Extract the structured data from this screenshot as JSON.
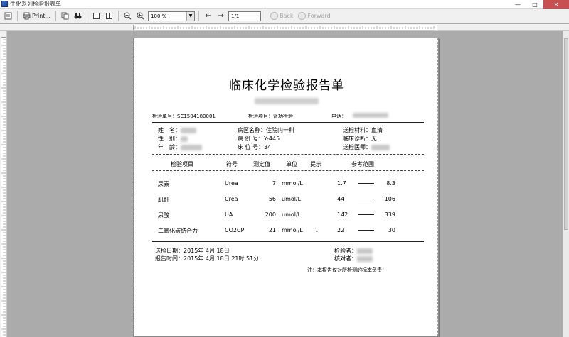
{
  "window": {
    "title": "生化系列检验报表单"
  },
  "toolbar": {
    "print_label": "Print...",
    "zoom_value": "100 %",
    "page_value": "1/1",
    "back_label": "Back",
    "forward_label": "Forward"
  },
  "report": {
    "title": "临床化学检验报告单",
    "top_row": {
      "sample_no": "检验单号：SC1504180001",
      "item": "检验项目：肾功检验",
      "phone": "电话："
    },
    "patient": {
      "name_label": "姓　名：",
      "sex_label": "性　别：",
      "age_label": "年　龄：",
      "dept": "病区名称：住院内一科",
      "record": "病 例 号：Y-445",
      "bed": "床 位 号：34",
      "material": "送检材料：血清",
      "diagnosis": "临床诊断：无",
      "doctor": "送检医师："
    },
    "columns": [
      "检验项目",
      "符号",
      "测定值",
      "单位",
      "提示",
      "参考范围"
    ],
    "rows": [
      {
        "name": "尿素",
        "symbol": "Urea",
        "value": "7",
        "unit": "mmol/L",
        "flag": "",
        "low": "1.7",
        "high": "8.3"
      },
      {
        "name": "肌酐",
        "symbol": "Crea",
        "value": "56",
        "unit": "umol/L",
        "flag": "",
        "low": "44",
        "high": "106"
      },
      {
        "name": "尿酸",
        "symbol": "UA",
        "value": "200",
        "unit": "umol/L",
        "flag": "",
        "low": "142",
        "high": "339"
      },
      {
        "name": "二氧化碳结合力",
        "symbol": "CO2CP",
        "value": "21",
        "unit": "mmol/L",
        "flag": "↓",
        "low": "22",
        "high": "30"
      }
    ],
    "footer": {
      "send_date": "送检日期：2015年 4月 18日",
      "report_time": "报告时间：2015年 4月 18日 21时 51分",
      "tester": "检验者：",
      "checker": "核对者：",
      "note": "注：本报告仅对所检测的标本负责！"
    }
  }
}
